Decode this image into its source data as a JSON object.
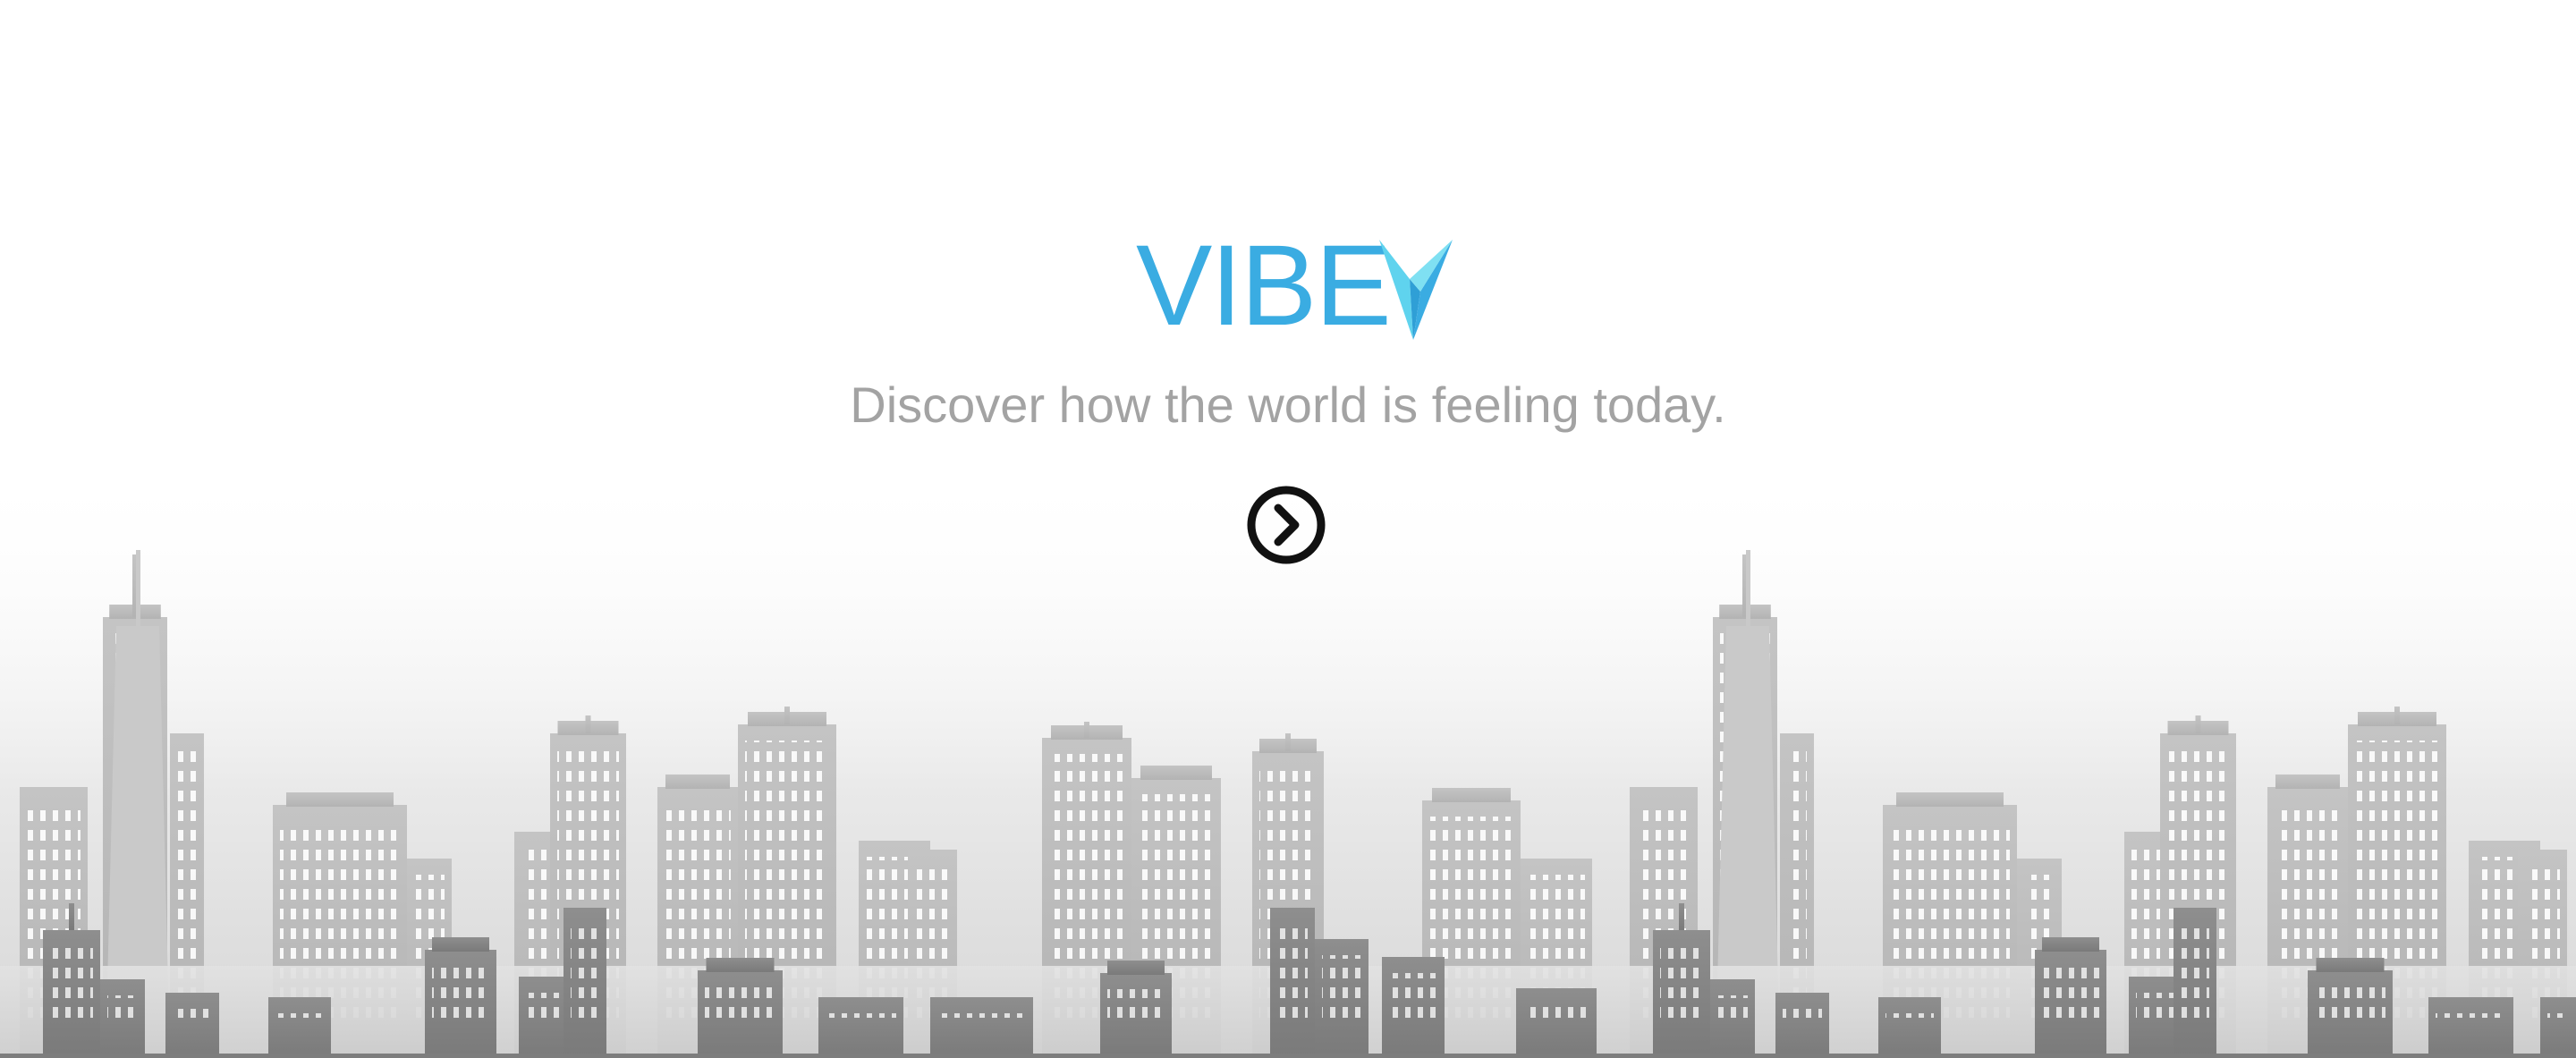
{
  "hero": {
    "logo_text": "VIBE",
    "tagline": "Discover how the world is feeling today."
  },
  "icons": {
    "logo_mark": "checkmark-icon",
    "next": "chevron-right-circle-icon"
  },
  "colors": {
    "brand": "#3aace2",
    "brand_light": "#5fd3ee",
    "tagline": "#a3a3a3",
    "button": "#111111",
    "background": "#ffffff"
  }
}
